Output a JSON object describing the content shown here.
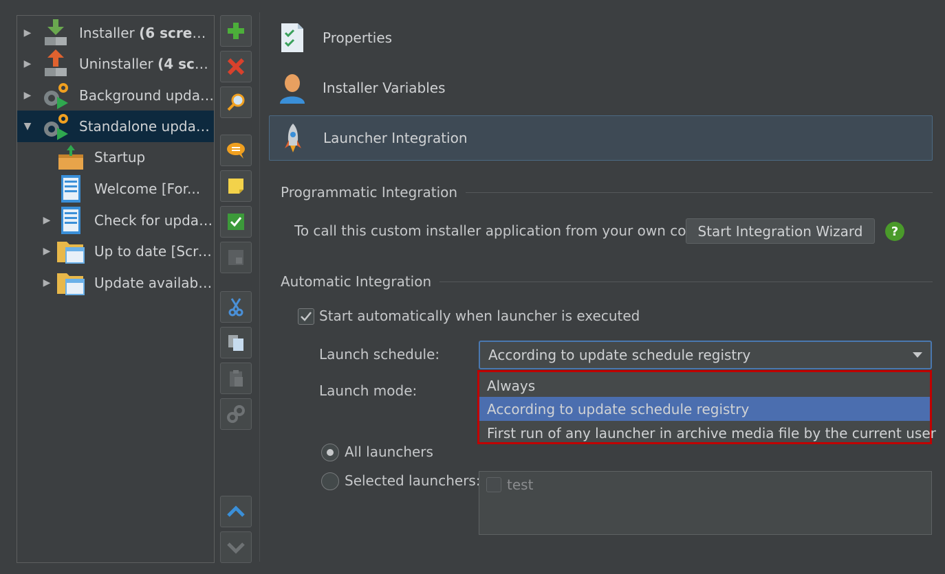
{
  "tree": [
    {
      "label": "Installer ",
      "bold": "(6 scree...",
      "arrow": "▶",
      "icon": "installer-icon"
    },
    {
      "label": "Uninstaller ",
      "bold": "(4 scree...",
      "arrow": "▶",
      "icon": "uninstaller-icon"
    },
    {
      "label": "Background update...",
      "bold": "",
      "arrow": "▶",
      "icon": "gears-play-icon"
    },
    {
      "label": "Standalone update ...",
      "bold": "",
      "arrow": "▼",
      "icon": "gears-play-icon"
    },
    {
      "label": "Startup",
      "bold": "",
      "arrow": "",
      "icon": "startup-box-icon"
    },
    {
      "label": "Welcome [For...",
      "bold": "",
      "arrow": "",
      "icon": "screen-document-icon"
    },
    {
      "label": "Check for updat...",
      "bold": "",
      "arrow": "▶",
      "icon": "screen-document-icon"
    },
    {
      "label": "Up to date [Scre...",
      "bold": "",
      "arrow": "▶",
      "icon": "folder-screen-icon"
    },
    {
      "label": "Update available...",
      "bold": "",
      "arrow": "▶",
      "icon": "folder-screen-icon"
    }
  ],
  "toolbar": [
    "add-icon",
    "delete-icon",
    "search-icon",
    "comment-icon",
    "note-icon",
    "check-icon",
    "folder-icon",
    "cut-icon",
    "copy-icon",
    "paste-icon",
    "link-icon",
    "move-up-icon",
    "move-down-icon"
  ],
  "sections": {
    "properties": "Properties",
    "variables": "Installer Variables",
    "launcher": "Launcher Integration"
  },
  "programmatic": {
    "title": "Programmatic Integration",
    "description": "To call this custom installer application from your own code:",
    "wizard_button": "Start Integration Wizard",
    "help": "?"
  },
  "automatic": {
    "title": "Automatic Integration",
    "start_auto_label": "Start automatically when launcher is executed",
    "start_auto_checked": true,
    "schedule_label": "Launch schedule:",
    "schedule_value": "According to update schedule registry",
    "schedule_options": [
      "Always",
      "According to update schedule registry",
      "First run of any launcher in archive media file by the current user"
    ],
    "mode_label": "Launch mode:",
    "all_launchers": "All launchers",
    "selected_launchers": "Selected launchers:",
    "launchers": [
      {
        "name": "test",
        "checked": false
      }
    ]
  },
  "colors": {
    "background": "#3c3f41",
    "selection": "#4b6eaf",
    "highlight_border": "#c00000",
    "tree_selection": "#0d293e"
  }
}
